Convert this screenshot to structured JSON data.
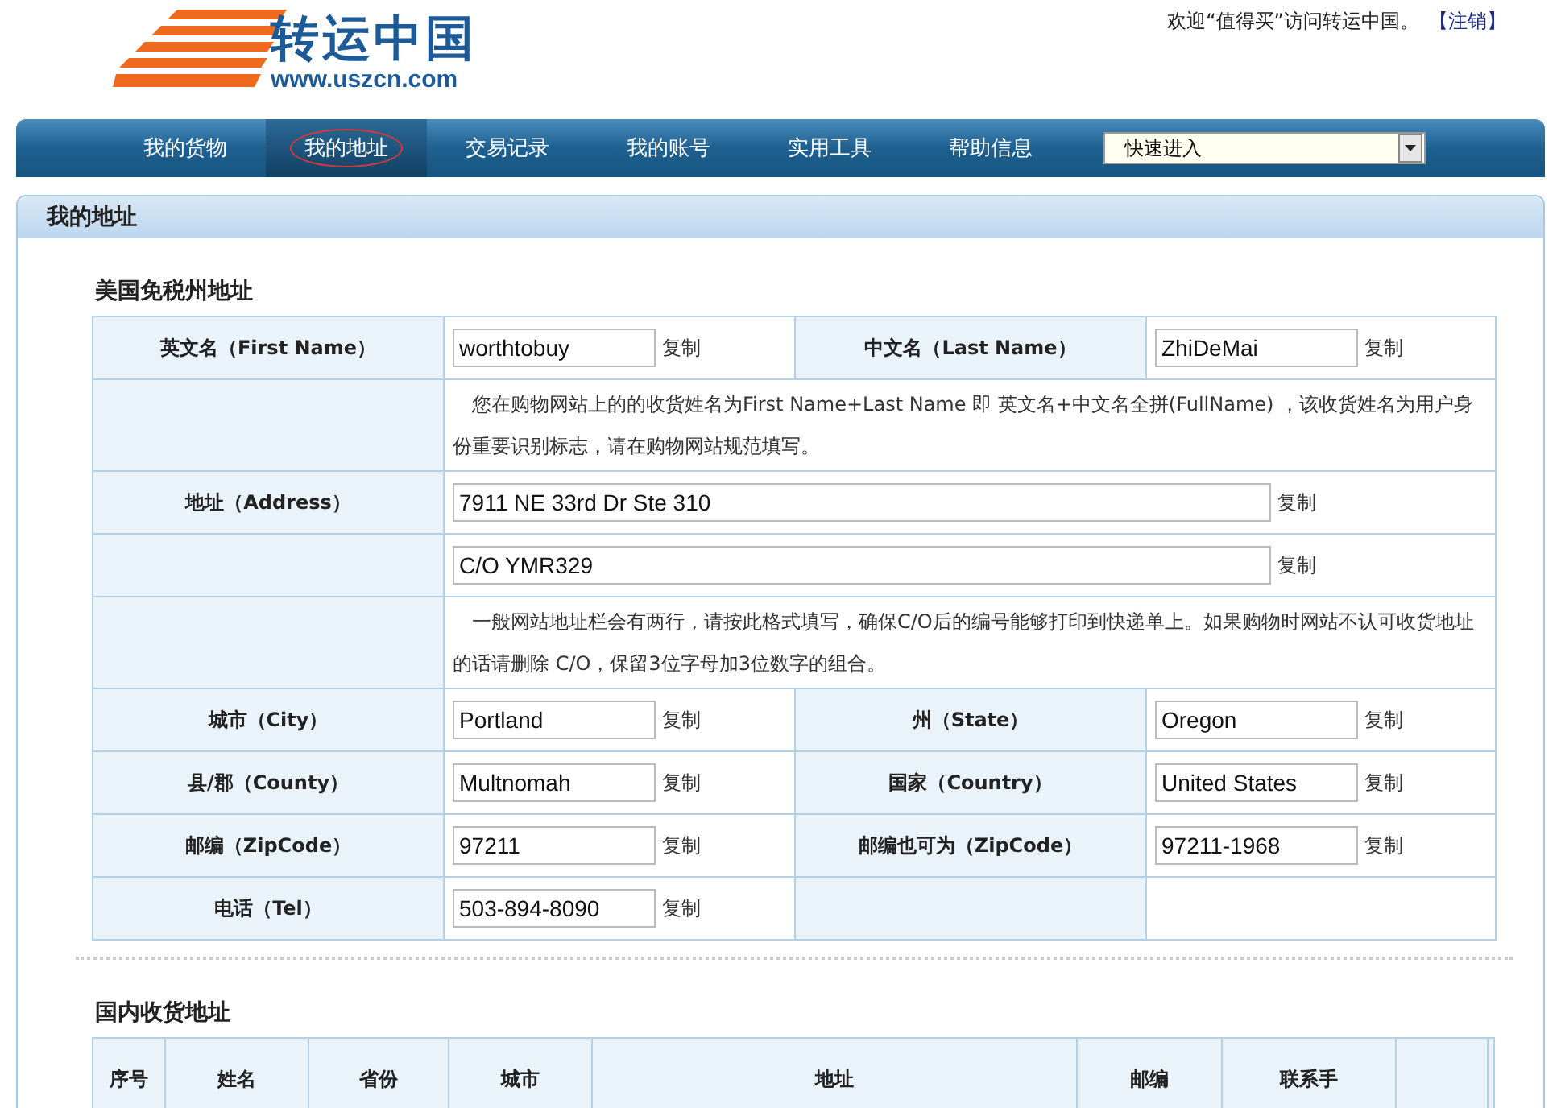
{
  "header": {
    "logo_title": "转运中国",
    "logo_url": "www.uszcn.com",
    "welcome": "欢迎“值得买”访问转运中国。",
    "logout": "【注销】"
  },
  "nav": {
    "items": [
      {
        "label": "我的货物",
        "selected": false
      },
      {
        "label": "我的地址",
        "selected": true
      },
      {
        "label": "交易记录",
        "selected": false
      },
      {
        "label": "我的账号",
        "selected": false
      },
      {
        "label": "实用工具",
        "selected": false
      },
      {
        "label": "帮助信息",
        "selected": false
      }
    ],
    "quick_select": "快速进入"
  },
  "panel": {
    "title": "我的地址"
  },
  "us_address": {
    "title": "美国免税州地址",
    "rows": [
      {
        "kind": "pair",
        "cells": [
          {
            "label": "英文名（First Name）",
            "value": "worthtobuy",
            "copy": "复制"
          },
          {
            "label": "中文名（Last Name）",
            "value": "ZhiDeMai",
            "copy": "复制"
          }
        ]
      },
      {
        "kind": "note",
        "text": "您在购物网站上的的收货姓名为First Name+Last Name 即 英文名+中文名全拼(FullName) ，该收货姓名为用户身份重要识别标志，请在购物网站规范填写。"
      },
      {
        "kind": "wide",
        "label": "地址（Address）",
        "value": "7911 NE 33rd Dr Ste 310",
        "copy": "复制"
      },
      {
        "kind": "wide",
        "value": "C/O YMR329",
        "copy": "复制"
      },
      {
        "kind": "note",
        "text": "一般网站地址栏会有两行，请按此格式填写，确保C/O后的编号能够打印到快递单上。如果购物时网站不认可收货地址的话请删除 C/O，保留3位字母加3位数字的组合。"
      },
      {
        "kind": "pair",
        "cells": [
          {
            "label": "城市（City）",
            "value": "Portland",
            "copy": "复制"
          },
          {
            "label": "州（State）",
            "value": "Oregon",
            "copy": "复制"
          }
        ]
      },
      {
        "kind": "pair",
        "cells": [
          {
            "label": "县/郡（County）",
            "value": "Multnomah",
            "copy": "复制"
          },
          {
            "label": "国家（Country）",
            "value": "United States",
            "copy": "复制"
          }
        ]
      },
      {
        "kind": "pair",
        "cells": [
          {
            "label": "邮编（ZipCode）",
            "value": "97211",
            "copy": "复制"
          },
          {
            "label": "邮编也可为（ZipCode）",
            "value": "97211-1968",
            "copy": "复制"
          }
        ]
      },
      {
        "kind": "pair",
        "cells": [
          {
            "label": "电话（Tel）",
            "value": "503-894-8090",
            "copy": "复制"
          }
        ]
      }
    ]
  },
  "domestic_address": {
    "title": "国内收货地址",
    "columns": [
      "序号",
      "姓名",
      "省份",
      "城市",
      "地址",
      "邮编",
      "联系手"
    ]
  }
}
